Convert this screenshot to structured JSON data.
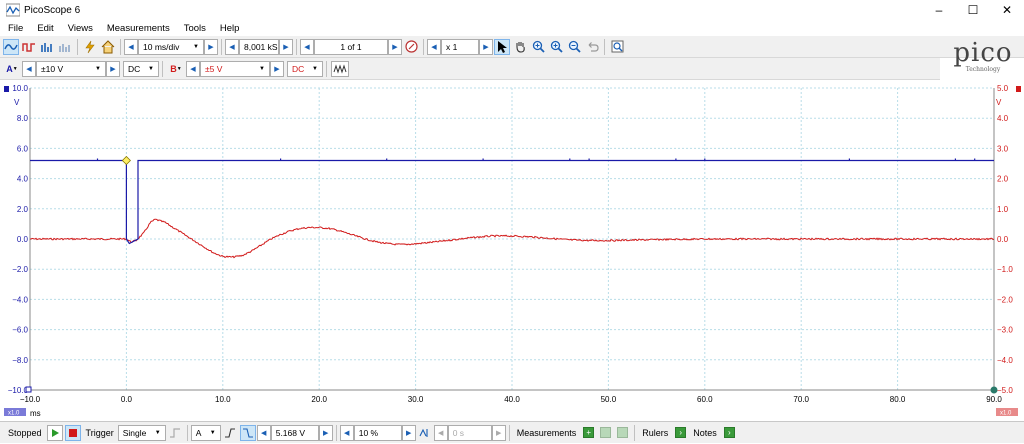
{
  "window": {
    "title": "PicoScope 6",
    "controls": [
      "–",
      "☐",
      "✕"
    ]
  },
  "menu": [
    "File",
    "Edit",
    "Views",
    "Measurements",
    "Tools",
    "Help"
  ],
  "toolbar": {
    "timebase": "10 ms/div",
    "samples": "8,001 kS",
    "buffer": "1 of 1",
    "zoom": "x 1"
  },
  "channels": {
    "a": {
      "letter": "A",
      "range": "±10 V",
      "coupling": "DC",
      "color": "#1a1aa8"
    },
    "b": {
      "letter": "B",
      "range": "±5 V",
      "coupling": "DC",
      "color": "#d11a1a"
    }
  },
  "logo": {
    "brand": "pico",
    "sub": "Technology"
  },
  "scope": {
    "left_axis": {
      "unit": "V",
      "ticks": [
        "10.0",
        "8.0",
        "6.0",
        "4.0",
        "2.0",
        "0.0",
        "−2.0",
        "−4.0",
        "−6.0",
        "−8.0",
        "−10.0"
      ]
    },
    "right_axis": {
      "unit": "V",
      "ticks": [
        "5.0",
        "4.0",
        "3.0",
        "2.0",
        "1.0",
        "0.0",
        "−1.0",
        "−2.0",
        "−3.0",
        "−4.0",
        "−5.0"
      ]
    },
    "x_ticks": [
      "−10.0",
      "0.0",
      "10.0",
      "20.0",
      "30.0",
      "40.0",
      "50.0",
      "60.0",
      "70.0",
      "80.0",
      "90.0"
    ],
    "x_unit": "ms",
    "left_zoom": "x1.0",
    "right_zoom": "x1.0"
  },
  "chart_data": {
    "type": "line",
    "xlim": [
      -10,
      90
    ],
    "series": [
      {
        "channel": "A",
        "ylim": [
          -10,
          10
        ],
        "x": [
          -10,
          0,
          0,
          0.3,
          1.2,
          1.2,
          90
        ],
        "y": [
          5.2,
          5.2,
          0,
          -0.3,
          0,
          5.2,
          5.2
        ]
      },
      {
        "channel": "B",
        "ylim": [
          -5,
          5
        ],
        "x": [
          -10,
          0,
          0.5,
          1,
          1.8,
          2.5,
          3,
          4,
          5,
          6,
          7,
          8,
          9,
          10,
          11,
          12,
          13,
          14,
          15,
          16,
          17,
          18,
          19,
          20,
          21,
          22,
          23,
          24,
          25,
          26,
          27,
          28,
          29,
          30,
          32,
          34,
          36,
          38,
          40,
          42,
          44,
          46,
          48,
          50,
          55,
          60,
          70,
          80,
          90
        ],
        "y": [
          0,
          0,
          -0.1,
          -0.05,
          0.2,
          0.55,
          0.65,
          0.55,
          0.35,
          0.15,
          -0.05,
          -0.25,
          -0.45,
          -0.58,
          -0.6,
          -0.55,
          -0.4,
          -0.2,
          0,
          0.15,
          0.27,
          0.35,
          0.38,
          0.38,
          0.35,
          0.28,
          0.18,
          0.08,
          -0.02,
          -0.1,
          -0.15,
          -0.18,
          -0.18,
          -0.16,
          -0.1,
          -0.02,
          0.05,
          0.1,
          0.1,
          0.07,
          0.02,
          -0.03,
          -0.05,
          -0.05,
          -0.02,
          0,
          0,
          0,
          0
        ]
      }
    ]
  },
  "status": {
    "run_state": "Stopped",
    "trigger_label": "Trigger",
    "trigger_mode": "Single",
    "trigger_source": "A",
    "trigger_level": "5.168 V",
    "pre_trigger": "10 %",
    "delay": "0 s",
    "measurements_label": "Measurements",
    "rulers_label": "Rulers",
    "notes_label": "Notes"
  }
}
